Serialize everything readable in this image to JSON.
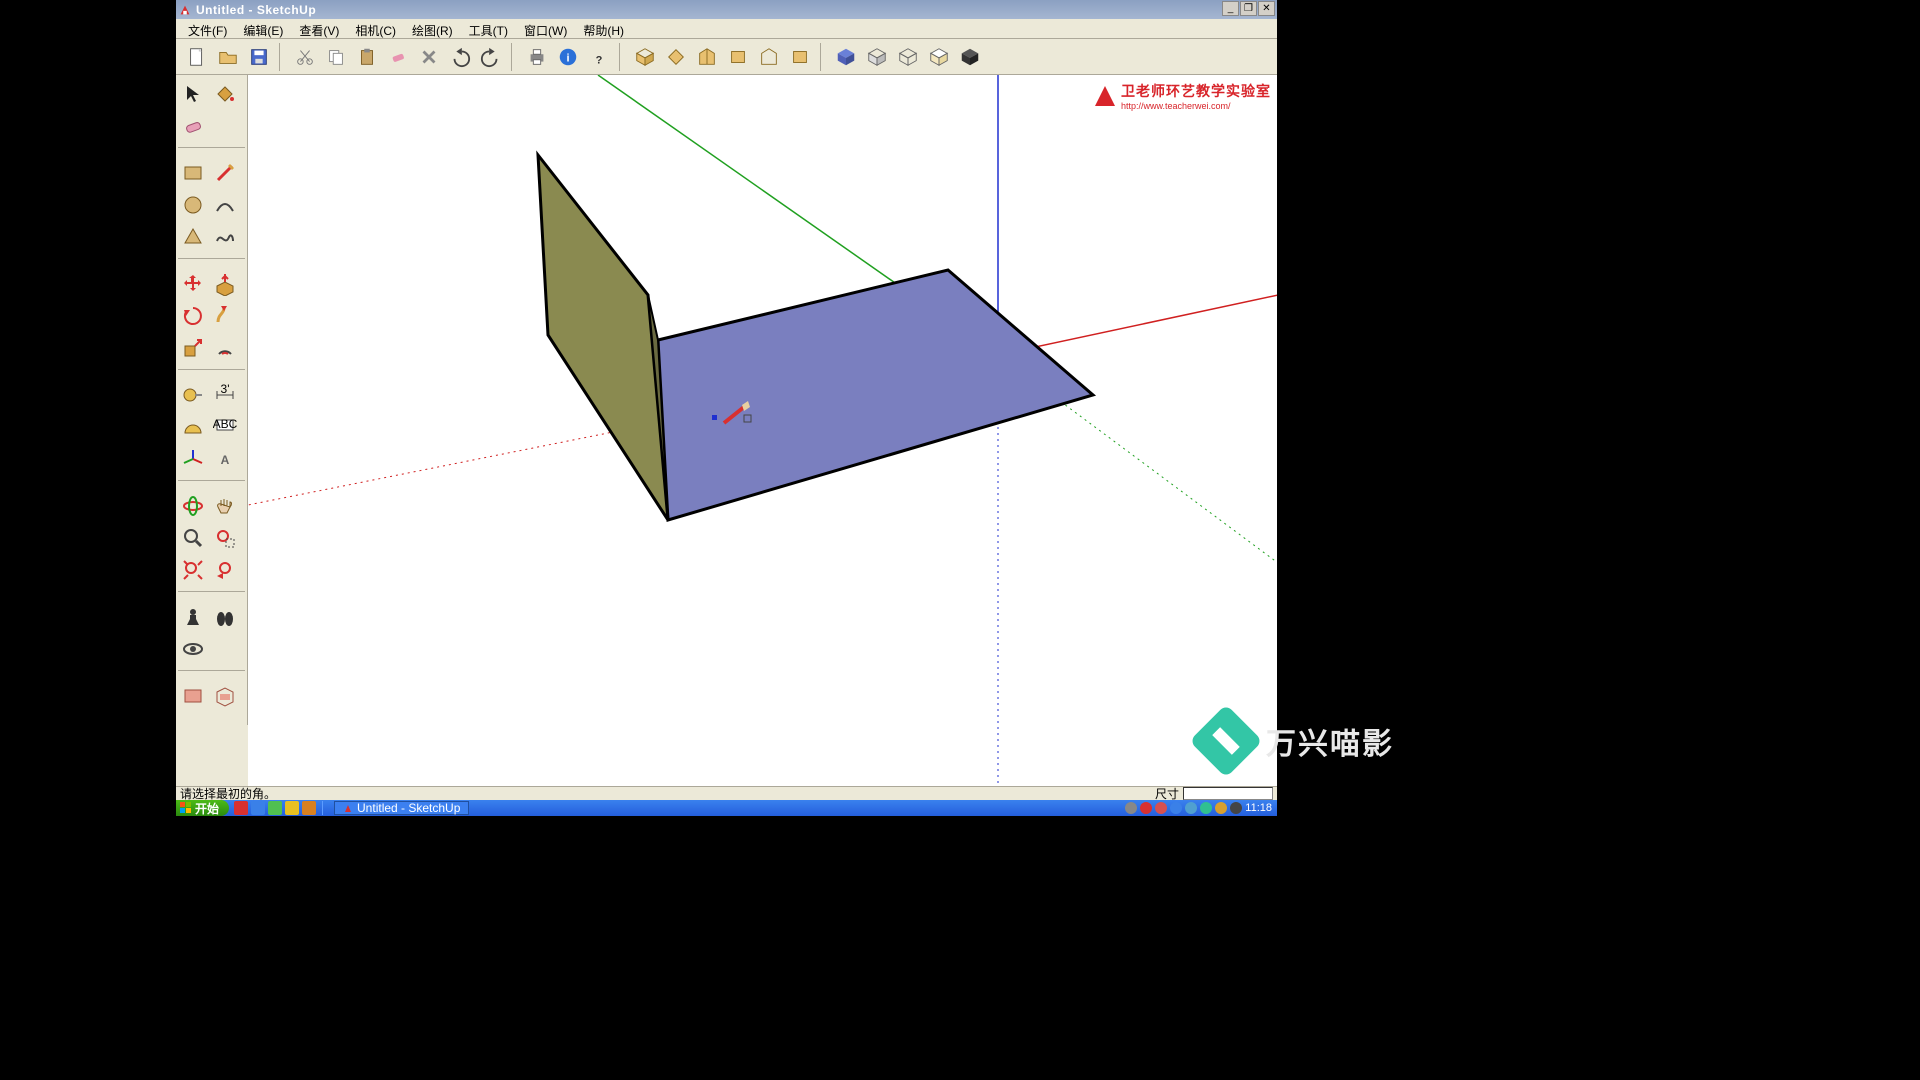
{
  "window": {
    "title": "Untitled - SketchUp"
  },
  "menu": {
    "file": "文件(F)",
    "edit": "编辑(E)",
    "view": "查看(V)",
    "camera": "相机(C)",
    "draw": "绘图(R)",
    "tools": "工具(T)",
    "window": "窗口(W)",
    "help": "帮助(H)"
  },
  "status": {
    "hint": "请选择最初的角。",
    "dim_label": "尺寸",
    "dim_value": ""
  },
  "taskbar": {
    "start": "开始",
    "app": "Untitled - SketchUp",
    "clock": "11:18"
  },
  "watermark": {
    "title": "卫老师环艺教学实验室",
    "url": "http://www.teacherwei.com/"
  },
  "editor_wm": "万兴喵影"
}
